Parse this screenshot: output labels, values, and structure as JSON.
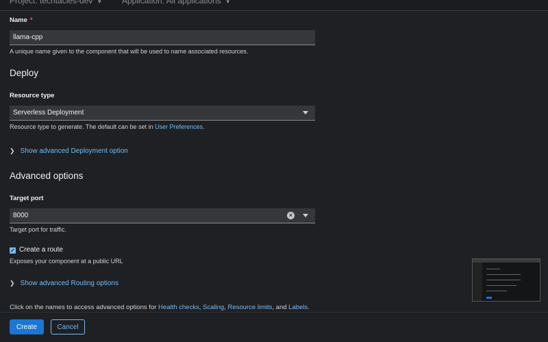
{
  "topbar": {
    "project_label": "Project: techtacles-dev",
    "application_label": "Application: All applications"
  },
  "name": {
    "label": "Name",
    "required_mark": "*",
    "value": "llama-cpp",
    "helper": "A unique name given to the component that will be used to name associated resources."
  },
  "deploy": {
    "heading": "Deploy",
    "resource_type_label": "Resource type",
    "resource_type_value": "Serverless Deployment",
    "helper_prefix": "Resource type to generate. The default can be set in ",
    "helper_link": "User Preferences",
    "helper_suffix": ".",
    "advanced_link": "Show advanced Deployment option"
  },
  "advanced": {
    "heading": "Advanced options",
    "target_port_label": "Target port",
    "target_port_value": "8000",
    "target_port_helper": "Target port for traffic.",
    "route_checkbox_label": "Create a route",
    "route_checked": true,
    "route_helper": "Exposes your component at a public URL",
    "routing_link": "Show advanced Routing options",
    "footer_text_prefix": "Click on the names to access advanced options for ",
    "links": {
      "health": "Health checks",
      "scaling": "Scaling",
      "resource_limits": "Resource limits",
      "labels": "Labels"
    },
    "sep1": ", ",
    "sep2": ", ",
    "sep3": ", and ",
    "end": "."
  },
  "footer": {
    "create_label": "Create",
    "cancel_label": "Cancel"
  },
  "icons": {
    "caret": "caret-down-icon",
    "chevron": "chevron-right-icon",
    "clear": "times-circle-icon",
    "check": "check-icon"
  },
  "colors": {
    "background": "#1f2023",
    "input_bg": "#36373a",
    "link": "#73bcf7",
    "primary": "#1b77d4",
    "required": "#f0625f"
  }
}
